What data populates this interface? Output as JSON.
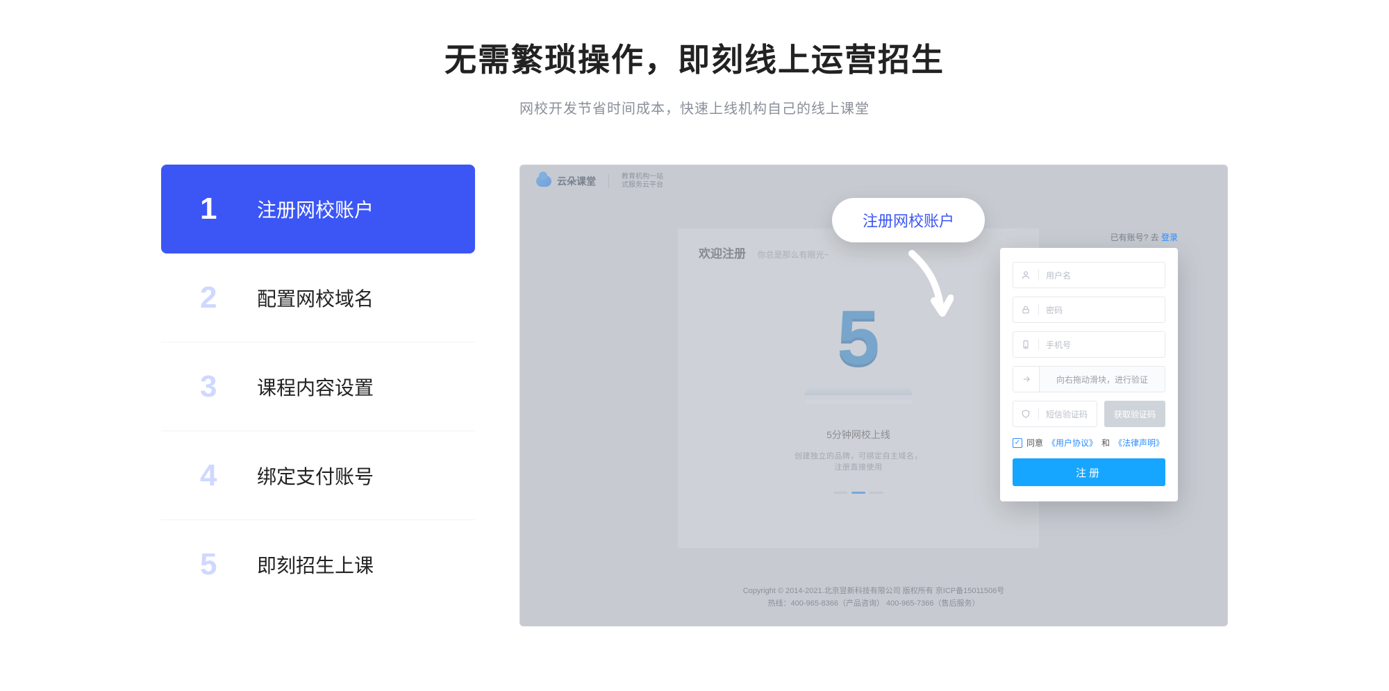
{
  "hero": {
    "title": "无需繁琐操作，即刻线上运营招生",
    "subtitle": "网校开发节省时间成本，快速上线机构自己的线上课堂"
  },
  "steps": [
    {
      "num": "1",
      "label": "注册网校账户",
      "active": true
    },
    {
      "num": "2",
      "label": "配置网校域名",
      "active": false
    },
    {
      "num": "3",
      "label": "课程内容设置",
      "active": false
    },
    {
      "num": "4",
      "label": "绑定支付账号",
      "active": false
    },
    {
      "num": "5",
      "label": "即刻招生上课",
      "active": false
    }
  ],
  "mock": {
    "logo_text": "云朵课堂",
    "logo_tag_line1": "教育机构一站",
    "logo_tag_line2": "式服务云平台",
    "welcome_title": "欢迎注册",
    "welcome_sub": "你总是那么有眼光~",
    "already_prefix": "已有账号? 去 ",
    "already_link": "登录",
    "five_caption": "5分钟网校上线",
    "five_desc": "创建独立的品牌，可绑定自主域名，注册直接使用",
    "footer_line1": "Copyright © 2014-2021.北京昱新科技有限公司 版权所有   京ICP备15011506号",
    "footer_line2": "热线：400-965-8366（产品咨询）  400-965-7366（售后服务）"
  },
  "callout_label": "注册网校账户",
  "form": {
    "username_ph": "用户名",
    "password_ph": "密码",
    "phone_ph": "手机号",
    "slider_text": "向右拖动滑块，进行验证",
    "code_ph": "短信验证码",
    "code_btn": "获取验证码",
    "agree_prefix": "同意",
    "agree_link1": "《用户协议》",
    "agree_mid": "和",
    "agree_link2": "《法律声明》",
    "submit": "注册"
  }
}
